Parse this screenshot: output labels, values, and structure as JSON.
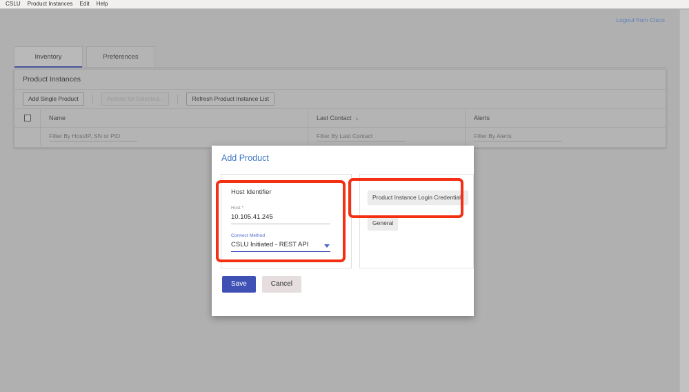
{
  "menubar": {
    "items": [
      {
        "label": "CSLU"
      },
      {
        "label": "Product Instances"
      },
      {
        "label": "Edit"
      },
      {
        "label": "Help"
      }
    ]
  },
  "header": {
    "logout_label": "Logout from Cisco",
    "logout_color": "#5b7fbd"
  },
  "tabs": [
    {
      "label": "Inventory",
      "active": true
    },
    {
      "label": "Preferences",
      "active": false
    }
  ],
  "panel": {
    "title": "Product Instances",
    "toolbar": {
      "add_single_product": "Add Single Product",
      "actions_for_selected": "Actions for Selected...",
      "refresh_list": "Refresh Product Instance List"
    },
    "table": {
      "columns": [
        {
          "header": "Name",
          "filter_placeholder": "Filter By Host/IP, SN or PID",
          "sorted": false
        },
        {
          "header": "Last Contact",
          "filter_placeholder": "Filter By Last Contact",
          "sorted": true,
          "sort_glyph": "↓"
        },
        {
          "header": "Alerts",
          "filter_placeholder": "Filter By Alerts",
          "sorted": false
        }
      ],
      "rows": []
    }
  },
  "modal": {
    "title": "Add Product",
    "title_color": "#4278c8",
    "left_panel": {
      "heading": "Host Identifier",
      "fields": [
        {
          "label": "Host *",
          "value": "10.105.41.245",
          "type": "text",
          "focused": false
        },
        {
          "label": "Connect Method",
          "value": "CSLU Initiated - REST API",
          "type": "select",
          "focused": true
        }
      ]
    },
    "right_panel": {
      "buttons": [
        {
          "label": "Product Instance Login Credentials",
          "highlighted": true
        },
        {
          "label": "General",
          "highlighted": false
        }
      ]
    },
    "actions": {
      "save_label": "Save",
      "save_color": "#3f51b5",
      "cancel_label": "Cancel"
    }
  },
  "annotations": {
    "color": "#f42f12",
    "boxes": [
      {
        "target": "host-identifier-section"
      },
      {
        "target": "product-instance-login-credentials-button"
      }
    ]
  }
}
